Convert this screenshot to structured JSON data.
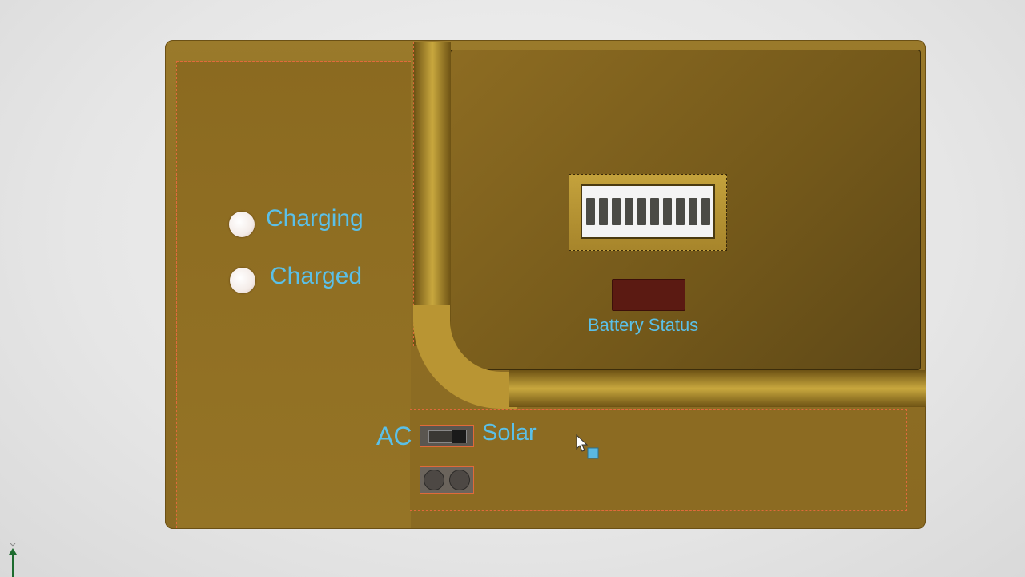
{
  "indicators": {
    "charging_label": "Charging",
    "charged_label": "Charged"
  },
  "battery": {
    "segments": 10,
    "status_label": "Battery Status"
  },
  "source_switch": {
    "left_label": "AC",
    "right_label": "Solar",
    "selected": "Solar"
  },
  "colors": {
    "panel": "#8f6e24",
    "label": "#5bc0e8",
    "status_indicator": "#5b1a12"
  },
  "icons": [
    "cursor-icon",
    "axis-indicator-icon"
  ]
}
